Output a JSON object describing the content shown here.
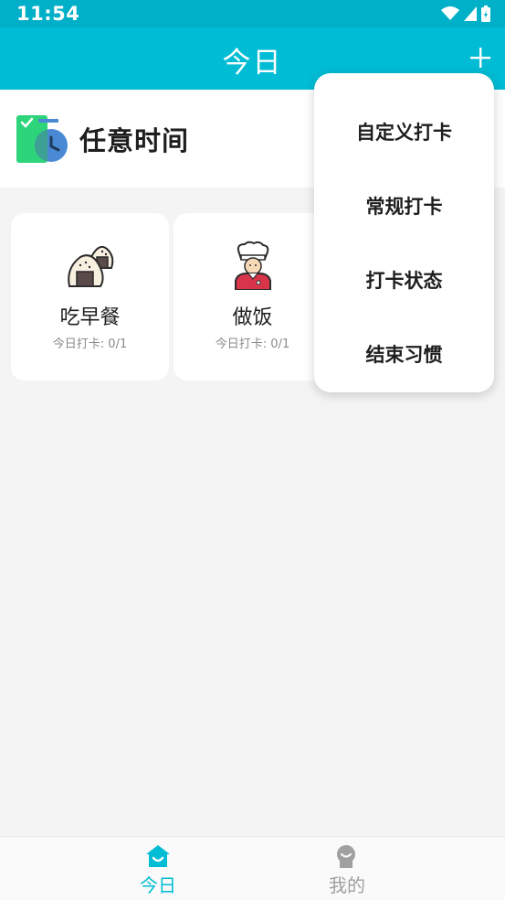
{
  "status_bar": {
    "time": "11:54",
    "icons": [
      "wifi-icon",
      "signal-icon",
      "battery-icon"
    ]
  },
  "app_bar": {
    "title": "今日",
    "add_icon": "plus-icon",
    "background": "#00bcd4"
  },
  "section": {
    "title": "任意时间",
    "icon": "timer-clock-icon"
  },
  "habits": [
    {
      "name": "吃早餐",
      "progress": "今日打卡: 0/1",
      "icon": "rice-ball-icon"
    },
    {
      "name": "做饭",
      "progress": "今日打卡: 0/1",
      "icon": "chef-icon"
    }
  ],
  "dropdown_menu": {
    "items": [
      {
        "label": "自定义打卡"
      },
      {
        "label": "常规打卡"
      },
      {
        "label": "打卡状态"
      },
      {
        "label": "结束习惯"
      }
    ]
  },
  "bottom_nav": {
    "items": [
      {
        "label": "今日",
        "icon": "home-icon",
        "active": true
      },
      {
        "label": "我的",
        "icon": "profile-icon",
        "active": false
      }
    ],
    "active_color": "#00bcd4",
    "inactive_color": "#a0a0a0"
  }
}
